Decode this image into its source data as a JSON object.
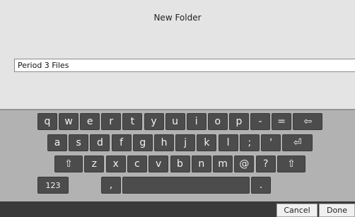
{
  "dialog": {
    "title": "New Folder",
    "name_value": "Period 3 Files"
  },
  "keyboard": {
    "row1": [
      "q",
      "w",
      "e",
      "r",
      "t",
      "y",
      "u",
      "i",
      "o",
      "p",
      "-",
      "=",
      "⇦"
    ],
    "row2": [
      "a",
      "s",
      "d",
      "f",
      "g",
      "h",
      "j",
      "k",
      "l",
      ";",
      "'",
      "⏎"
    ],
    "row3": [
      "⇧",
      "z",
      "x",
      "c",
      "v",
      "b",
      "n",
      "m",
      "@",
      "?",
      "⇧"
    ],
    "row4": [
      "123",
      ",",
      "",
      "."
    ]
  },
  "buttons": {
    "cancel": "Cancel",
    "done": "Done"
  }
}
